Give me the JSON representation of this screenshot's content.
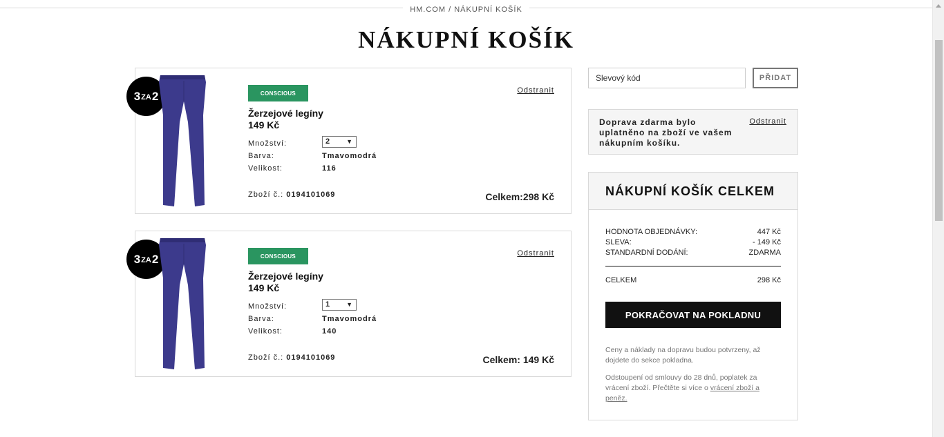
{
  "breadcrumb": "HM.COM / NÁKUPNÍ KOŠÍK",
  "page_title": "NÁKUPNÍ KOŠÍK",
  "labels": {
    "quantity": "Množství:",
    "color": "Barva:",
    "size": "Velikost:",
    "article_no": "Zboží č.:",
    "remove": "Odstranit"
  },
  "items": [
    {
      "promo_badge": {
        "left": "3",
        "mid": "ZA",
        "right": "2"
      },
      "tag": "CONSCIOUS",
      "name": "Žerzejové legíny",
      "price": "149 Kč",
      "quantity": "2",
      "color": "Tmavomodrá",
      "size": "116",
      "article_no": "0194101069",
      "total": "Celkem:298 Kč"
    },
    {
      "promo_badge": {
        "left": "3",
        "mid": "ZA",
        "right": "2"
      },
      "tag": "CONSCIOUS",
      "name": "Žerzejové legíny",
      "price": "149 Kč",
      "quantity": "1",
      "color": "Tmavomodrá",
      "size": "140",
      "article_no": "0194101069",
      "total": "Celkem: 149 Kč"
    }
  ],
  "discount": {
    "placeholder": "Slevový kód",
    "button_label": "PŘIDAT"
  },
  "shipping_notice": {
    "text": "Doprava zdarma bylo uplatněno na zboží ve vašem nákupním košíku.",
    "remove_label": "Odstranit"
  },
  "summary": {
    "title": "NÁKUPNÍ KOŠÍK CELKEM",
    "rows": [
      {
        "label": "HODNOTA OBJEDNÁVKY:",
        "value": "447 Kč"
      },
      {
        "label": "SLEVA:",
        "value": "- 149 Kč"
      },
      {
        "label": "STANDARDNÍ DODÁNÍ:",
        "value": "ZDARMA"
      }
    ],
    "total": {
      "label": "CELKEM",
      "value": "298 Kč"
    },
    "checkout_label": "POKRAČOVAT NA POKLADNU",
    "note_1": "Ceny a náklady na dopravu budou potvrzeny, až dojdete do sekce pokladna.",
    "note_2_text": "Odstoupení od smlouvy do 28 dnů, poplatek za vrácení zboží. Přečtěte si více o ",
    "note_2_link": "vrácení zboží a peněz."
  },
  "colors": {
    "conscious_tag": "#2a9560",
    "product": "#3c3a8c",
    "checkout": "#111111"
  },
  "icons": {
    "product_image": "leggings-image",
    "select_caret": "▼"
  }
}
